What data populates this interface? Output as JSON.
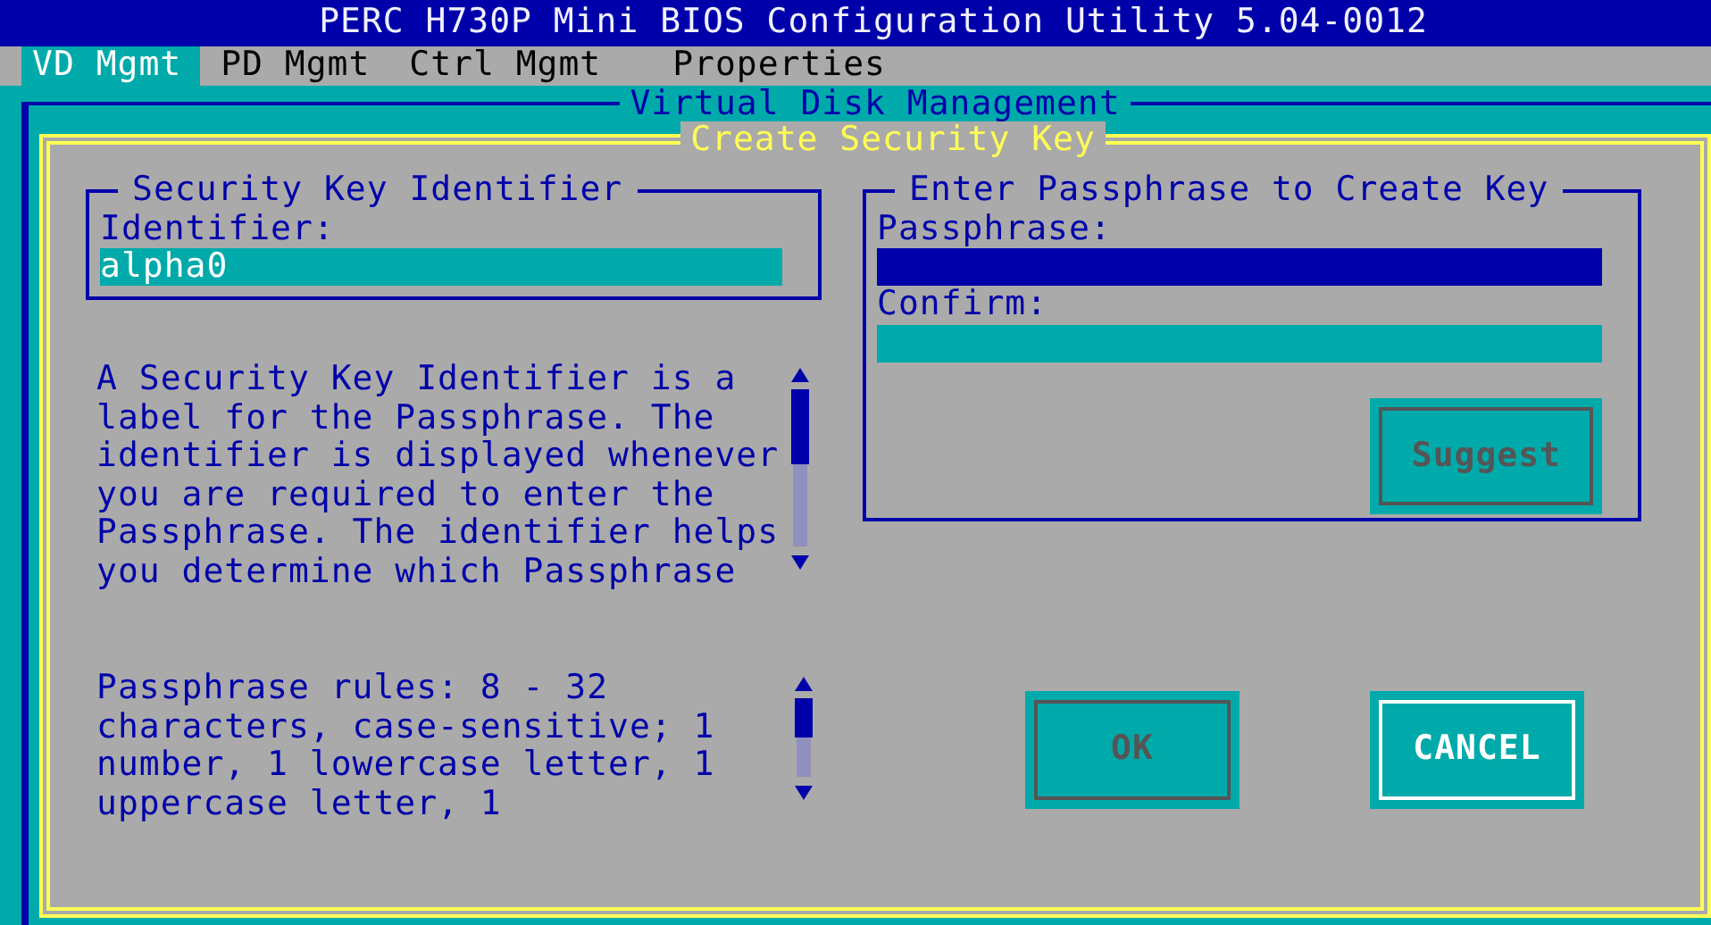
{
  "window": {
    "title": "PERC H730P Mini BIOS Configuration Utility 5.04-0012"
  },
  "tabs": [
    {
      "label": "VD Mgmt",
      "selected": true
    },
    {
      "label": "PD Mgmt",
      "selected": false
    },
    {
      "label": "Ctrl Mgmt",
      "selected": false
    },
    {
      "label": "Properties",
      "selected": false
    }
  ],
  "panel": {
    "title": "Virtual Disk Management"
  },
  "dialog": {
    "title": "Create Security Key",
    "identifier_group": {
      "title": "Security Key Identifier",
      "label": "Identifier:",
      "value": "alpha0"
    },
    "help_text": "A Security Key Identifier is a\nlabel for the Passphrase. The\nidentifier is displayed whenever\nyou are required to enter the\nPassphrase. The identifier helps\nyou determine which Passphrase",
    "rules_text": "Passphrase rules: 8 - 32\ncharacters, case-sensitive; 1\nnumber, 1 lowercase letter, 1\nuppercase letter, 1",
    "passphrase_group": {
      "title": "Enter Passphrase to Create Key",
      "fields": [
        {
          "label": "Passphrase:",
          "focused": true
        },
        {
          "label": "Confirm:",
          "focused": false
        }
      ],
      "suggest": {
        "label": "Suggest",
        "disabled": true
      }
    },
    "buttons": [
      {
        "label": "OK",
        "disabled": true
      },
      {
        "label": "CANCEL",
        "disabled": false
      }
    ]
  }
}
